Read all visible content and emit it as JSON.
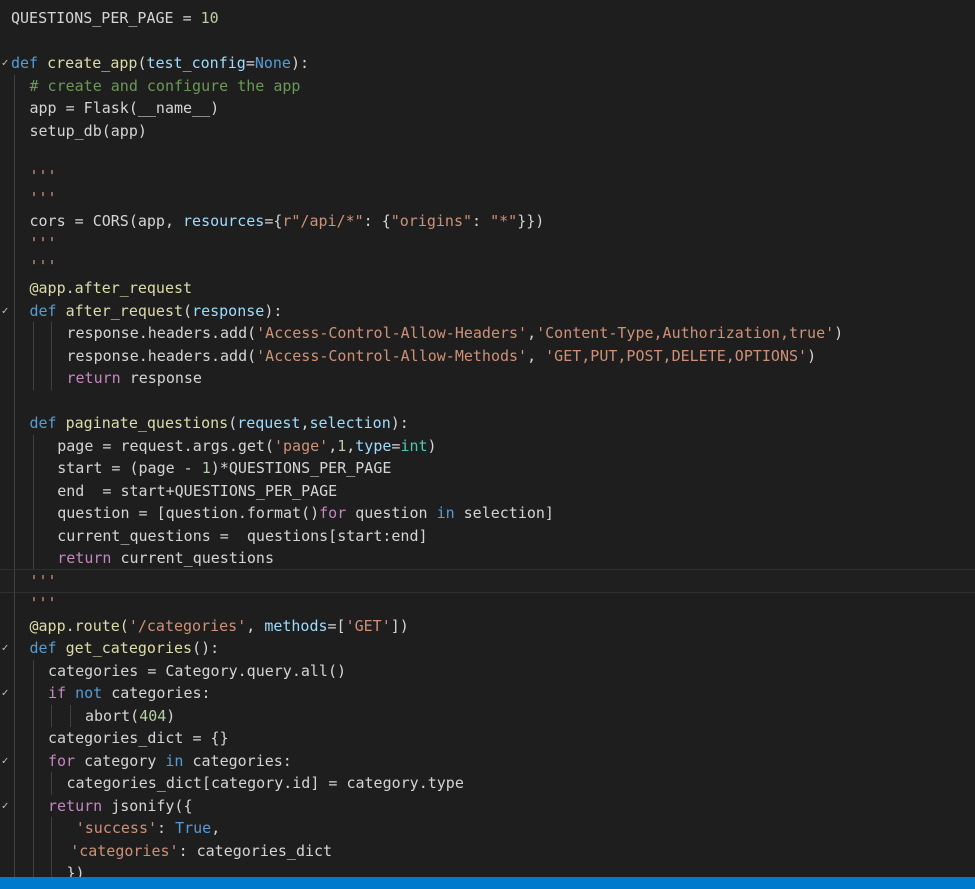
{
  "editor": {
    "theme_colors": {
      "background": "#1e1e1e",
      "keyword": "#569cd6",
      "control": "#c586c0",
      "function": "#dcdcaa",
      "variable": "#9cdcfe",
      "string": "#ce9178",
      "number": "#b5cea8",
      "comment": "#6a9955",
      "type": "#4ec9b0",
      "statusbar": "#007acc"
    },
    "lines": [
      {
        "indent": 0,
        "fold": false,
        "tokens": [
          {
            "t": "QUESTIONS_PER_PAGE",
            "c": "d"
          },
          {
            "t": " = ",
            "c": "d"
          },
          {
            "t": "10",
            "c": "n"
          }
        ]
      },
      {
        "indent": 0,
        "fold": false,
        "tokens": []
      },
      {
        "indent": 0,
        "fold": true,
        "tokens": [
          {
            "t": "def",
            "c": "k"
          },
          {
            "t": " ",
            "c": "d"
          },
          {
            "t": "create_app",
            "c": "f"
          },
          {
            "t": "(",
            "c": "d"
          },
          {
            "t": "test_config",
            "c": "v"
          },
          {
            "t": "=",
            "c": "d"
          },
          {
            "t": "None",
            "c": "k"
          },
          {
            "t": "):",
            "c": "d"
          }
        ]
      },
      {
        "indent": 1,
        "fold": false,
        "tokens": [
          {
            "t": "# create and configure the app",
            "c": "cm"
          }
        ]
      },
      {
        "indent": 1,
        "fold": false,
        "tokens": [
          {
            "t": "app = Flask(__name__)",
            "c": "d"
          }
        ]
      },
      {
        "indent": 1,
        "fold": false,
        "tokens": [
          {
            "t": "setup_db(app)",
            "c": "d"
          }
        ]
      },
      {
        "indent": 1,
        "fold": false,
        "tokens": []
      },
      {
        "indent": 1,
        "fold": false,
        "tokens": [
          {
            "t": "'''",
            "c": "s"
          }
        ]
      },
      {
        "indent": 1,
        "fold": false,
        "tokens": [
          {
            "t": "'''",
            "c": "s"
          }
        ]
      },
      {
        "indent": 1,
        "fold": false,
        "tokens": [
          {
            "t": "cors = CORS(app, ",
            "c": "d"
          },
          {
            "t": "resources",
            "c": "v"
          },
          {
            "t": "={",
            "c": "d"
          },
          {
            "t": "r\"/api/*\"",
            "c": "s"
          },
          {
            "t": ": {",
            "c": "d"
          },
          {
            "t": "\"origins\"",
            "c": "s"
          },
          {
            "t": ": ",
            "c": "d"
          },
          {
            "t": "\"*\"",
            "c": "s"
          },
          {
            "t": "}})",
            "c": "d"
          }
        ]
      },
      {
        "indent": 1,
        "fold": false,
        "tokens": [
          {
            "t": "'''",
            "c": "s"
          }
        ]
      },
      {
        "indent": 1,
        "fold": false,
        "tokens": [
          {
            "t": "'''",
            "c": "s"
          }
        ]
      },
      {
        "indent": 1,
        "fold": false,
        "tokens": [
          {
            "t": "@app.after_request",
            "c": "dc"
          }
        ]
      },
      {
        "indent": 1,
        "fold": true,
        "tokens": [
          {
            "t": "def",
            "c": "k"
          },
          {
            "t": " ",
            "c": "d"
          },
          {
            "t": "after_request",
            "c": "f"
          },
          {
            "t": "(",
            "c": "d"
          },
          {
            "t": "response",
            "c": "v"
          },
          {
            "t": "):",
            "c": "d"
          }
        ]
      },
      {
        "indent": 3,
        "fold": false,
        "tokens": [
          {
            "t": "response.headers.add(",
            "c": "d"
          },
          {
            "t": "'Access-Control-Allow-Headers'",
            "c": "s"
          },
          {
            "t": ",",
            "c": "d"
          },
          {
            "t": "'Content-Type,Authorization,true'",
            "c": "s"
          },
          {
            "t": ")",
            "c": "d"
          }
        ]
      },
      {
        "indent": 3,
        "fold": false,
        "tokens": [
          {
            "t": "response.headers.add(",
            "c": "d"
          },
          {
            "t": "'Access-Control-Allow-Methods'",
            "c": "s"
          },
          {
            "t": ", ",
            "c": "d"
          },
          {
            "t": "'GET,PUT,POST,DELETE,OPTIONS'",
            "c": "s"
          },
          {
            "t": ")",
            "c": "d"
          }
        ]
      },
      {
        "indent": 3,
        "fold": false,
        "tokens": [
          {
            "t": "return",
            "c": "c"
          },
          {
            "t": " response",
            "c": "d"
          }
        ]
      },
      {
        "indent": 1,
        "fold": false,
        "tokens": []
      },
      {
        "indent": 1,
        "fold": false,
        "tokens": [
          {
            "t": "def",
            "c": "k"
          },
          {
            "t": " ",
            "c": "d"
          },
          {
            "t": "paginate_questions",
            "c": "f"
          },
          {
            "t": "(",
            "c": "d"
          },
          {
            "t": "request",
            "c": "v"
          },
          {
            "t": ",",
            "c": "d"
          },
          {
            "t": "selection",
            "c": "v"
          },
          {
            "t": "):",
            "c": "d"
          }
        ]
      },
      {
        "indent": 2.5,
        "fold": false,
        "tokens": [
          {
            "t": "page = request.args.get(",
            "c": "d"
          },
          {
            "t": "'page'",
            "c": "s"
          },
          {
            "t": ",",
            "c": "d"
          },
          {
            "t": "1",
            "c": "n"
          },
          {
            "t": ",",
            "c": "d"
          },
          {
            "t": "type",
            "c": "v"
          },
          {
            "t": "=",
            "c": "d"
          },
          {
            "t": "int",
            "c": "ty"
          },
          {
            "t": ")",
            "c": "d"
          }
        ]
      },
      {
        "indent": 2.5,
        "fold": false,
        "tokens": [
          {
            "t": "start = (page - ",
            "c": "d"
          },
          {
            "t": "1",
            "c": "n"
          },
          {
            "t": ")*QUESTIONS_PER_PAGE",
            "c": "d"
          }
        ]
      },
      {
        "indent": 2.5,
        "fold": false,
        "tokens": [
          {
            "t": "end  = start+QUESTIONS_PER_PAGE",
            "c": "d"
          }
        ]
      },
      {
        "indent": 2.5,
        "fold": false,
        "tokens": [
          {
            "t": "question = [question.format()",
            "c": "d"
          },
          {
            "t": "for",
            "c": "c"
          },
          {
            "t": " question ",
            "c": "d"
          },
          {
            "t": "in",
            "c": "k"
          },
          {
            "t": " selection]",
            "c": "d"
          }
        ]
      },
      {
        "indent": 2.5,
        "fold": false,
        "tokens": [
          {
            "t": "current_questions =  questions[start:end]",
            "c": "d"
          }
        ]
      },
      {
        "indent": 2.5,
        "fold": false,
        "tokens": [
          {
            "t": "return",
            "c": "c"
          },
          {
            "t": " current_questions",
            "c": "d"
          }
        ]
      },
      {
        "indent": 1,
        "fold": false,
        "current": true,
        "tokens": [
          {
            "t": "'''",
            "c": "s"
          }
        ]
      },
      {
        "indent": 1,
        "fold": false,
        "tokens": [
          {
            "t": "'''",
            "c": "s"
          }
        ]
      },
      {
        "indent": 1,
        "fold": false,
        "tokens": [
          {
            "t": "@app.route(",
            "c": "dc"
          },
          {
            "t": "'/categories'",
            "c": "s"
          },
          {
            "t": ", ",
            "c": "d"
          },
          {
            "t": "methods",
            "c": "v"
          },
          {
            "t": "=[",
            "c": "d"
          },
          {
            "t": "'GET'",
            "c": "s"
          },
          {
            "t": "])",
            "c": "d"
          }
        ]
      },
      {
        "indent": 1,
        "fold": true,
        "tokens": [
          {
            "t": "def",
            "c": "k"
          },
          {
            "t": " ",
            "c": "d"
          },
          {
            "t": "get_categories",
            "c": "f"
          },
          {
            "t": "():",
            "c": "d"
          }
        ]
      },
      {
        "indent": 2,
        "fold": false,
        "tokens": [
          {
            "t": "categories = Category.query.all()",
            "c": "d"
          }
        ]
      },
      {
        "indent": 2,
        "fold": true,
        "tokens": [
          {
            "t": "if",
            "c": "c"
          },
          {
            "t": " ",
            "c": "d"
          },
          {
            "t": "not",
            "c": "k"
          },
          {
            "t": " categories:",
            "c": "d"
          }
        ]
      },
      {
        "indent": 4,
        "fold": false,
        "tokens": [
          {
            "t": "abort(",
            "c": "d"
          },
          {
            "t": "404",
            "c": "n"
          },
          {
            "t": ")",
            "c": "d"
          }
        ]
      },
      {
        "indent": 2,
        "fold": false,
        "tokens": [
          {
            "t": "categories_dict = {}",
            "c": "d"
          }
        ]
      },
      {
        "indent": 2,
        "fold": true,
        "tokens": [
          {
            "t": "for",
            "c": "c"
          },
          {
            "t": " category ",
            "c": "d"
          },
          {
            "t": "in",
            "c": "k"
          },
          {
            "t": " categories:",
            "c": "d"
          }
        ]
      },
      {
        "indent": 3,
        "fold": false,
        "tokens": [
          {
            "t": "categories_dict[category.id] = category.type",
            "c": "d"
          }
        ]
      },
      {
        "indent": 2,
        "fold": true,
        "tokens": [
          {
            "t": "return",
            "c": "c"
          },
          {
            "t": " jsonify({",
            "c": "d"
          }
        ]
      },
      {
        "indent": 3.5,
        "fold": false,
        "tokens": [
          {
            "t": "'success'",
            "c": "s"
          },
          {
            "t": ": ",
            "c": "d"
          },
          {
            "t": "True",
            "c": "k"
          },
          {
            "t": ",",
            "c": "d"
          }
        ]
      },
      {
        "indent": 3.2,
        "fold": false,
        "tokens": [
          {
            "t": "'categories'",
            "c": "s"
          },
          {
            "t": ": categories_dict",
            "c": "d"
          }
        ]
      },
      {
        "indent": 3,
        "fold": false,
        "tokens": [
          {
            "t": "})",
            "c": "d"
          }
        ]
      }
    ]
  }
}
